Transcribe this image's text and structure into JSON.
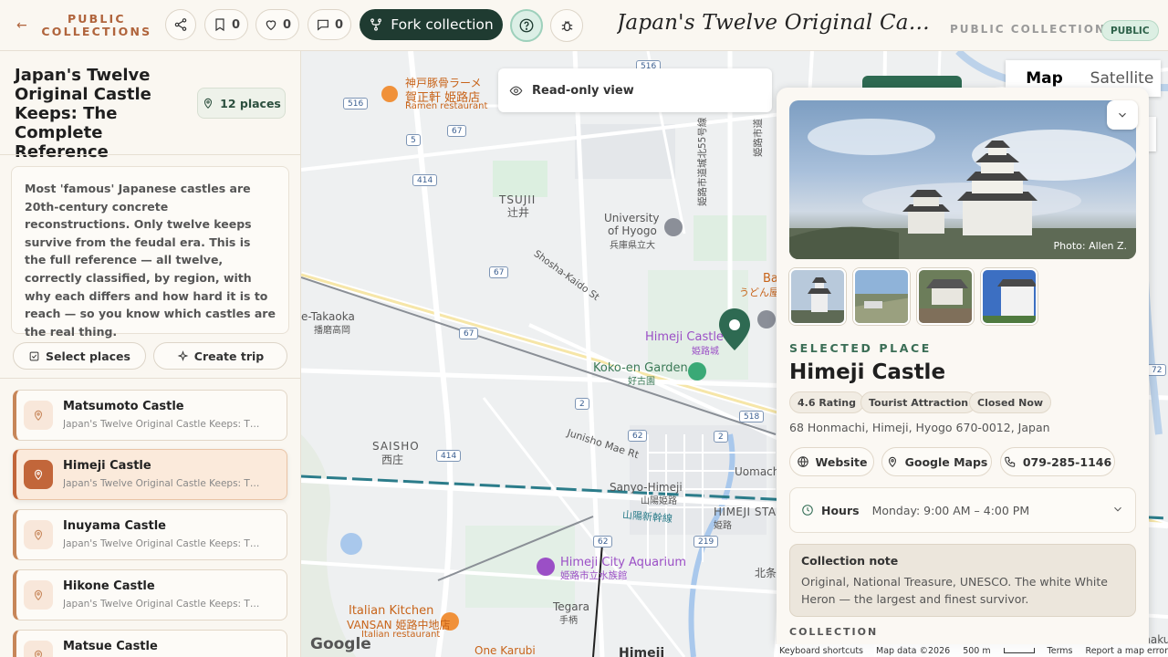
{
  "header": {
    "back_label": "PUBLIC COLLECTIONS",
    "share_icon": "share-icon",
    "bookmark_count": "0",
    "like_count": "0",
    "comment_count": "0",
    "fork_label": "Fork collection",
    "title": "Japan's Twelve Original Castle Ke...",
    "subtitle": "PUBLIC COLLECTION",
    "badge": "PUBLIC"
  },
  "sidebar": {
    "title": "Japan's Twelve Original Castle Keeps: The Complete Reference",
    "places_chip": "12 places",
    "description": "Most 'famous' Japanese castles are 20th-century concrete reconstructions. Only twelve keeps survive from the feudal era. This is the full reference — all twelve, correctly classified, by region, with why each differs and how hard it is to reach — so you know which castles are the real thing.",
    "select_label": "Select places",
    "trip_label": "Create trip",
    "places": [
      {
        "name": "Matsumoto Castle",
        "sub": "Japan's Twelve Original Castle Keeps: The Complete Reference"
      },
      {
        "name": "Himeji Castle",
        "sub": "Japan's Twelve Original Castle Keeps: The Complete Reference"
      },
      {
        "name": "Inuyama Castle",
        "sub": "Japan's Twelve Original Castle Keeps: The Complete Reference"
      },
      {
        "name": "Hikone Castle",
        "sub": "Japan's Twelve Original Castle Keeps: The Complete Reference"
      },
      {
        "name": "Matsue Castle",
        "sub": ""
      }
    ]
  },
  "map": {
    "readonly_label": "Read-only view",
    "map_label": "Map",
    "satellite_label": "Satellite",
    "labels": {
      "ramen_1": "神戸豚骨ラーメ",
      "ramen_2": "賀正軒 姫路店",
      "ramen_3": "Ramen restaurant",
      "tsujii_en": "TSUJII",
      "tsujii_jp": "辻井",
      "univ_1": "University",
      "univ_2": "of Hyogo",
      "univ_3": "兵庫県立大",
      "shosha": "Shosha-Kaido St",
      "takaoka_en": "e-Takaoka",
      "takaoka_jp": "播磨高岡",
      "himeji_castle": "Himeji Castle",
      "himeji_castle_jp": "姫路城",
      "kokoen": "Koko-en Garden",
      "kokoen_jp": "好古園",
      "saisho_en": "SAISHO",
      "saisho_jp": "西庄",
      "junisho": "Junisho Mae Rt",
      "uomachi": "Uomachi",
      "sanyo": "Sanyo-Himeji",
      "sanyo_jp": "山陽姫路",
      "himeji_sta": "HIMEJI STA",
      "himeji_sta_jp": "姫路",
      "shinkansen": "山陽新幹線",
      "aquarium": "Himeji City Aquarium",
      "aquarium_jp": "姫路市立水族館",
      "tegara": "Tegara",
      "tegara_jp": "手柄",
      "italian_1": "Italian Kitchen",
      "italian_2": "VANSAN 姫路中地店",
      "italian_3": "Italian restaurant",
      "one_karubi": "One Karubi",
      "himeji_city": "Himeji",
      "ba": "Ba",
      "udon": "うどん屋",
      "road_vertical": "姫路市道城北55号線",
      "road_vertical2": "姫路市道",
      "kita": "北条",
      "gochaku": "Gochaku"
    },
    "shields": [
      "516",
      "516",
      "5",
      "67",
      "414",
      "67",
      "67",
      "2",
      "62",
      "2",
      "518",
      "414",
      "62",
      "219",
      "72"
    ],
    "google": "Google",
    "attribution": [
      "Keyboard shortcuts",
      "Map data ©2026",
      "500 m",
      "Terms",
      "Report a map error"
    ]
  },
  "place": {
    "photo_credit": "Photo: Allen Z.",
    "eyebrow": "SELECTED PLACE",
    "name": "Himeji Castle",
    "tags": [
      "4.6 Rating",
      "Tourist Attraction",
      "Closed Now"
    ],
    "address": "68 Honmachi, Himeji, Hyogo 670-0012, Japan",
    "website_label": "Website",
    "maps_label": "Google Maps",
    "phone": "079-285-1146",
    "hours_label": "Hours",
    "hours_value": "Monday: 9:00 AM – 4:00 PM",
    "note_title": "Collection note",
    "note_body": "Original, National Treasure, UNESCO. The white White Heron — the largest and finest survivor.",
    "collection_header": "COLLECTION"
  },
  "colors": {
    "accent_green": "#1f3b31",
    "accent_rust": "#c2663a",
    "map_pin": "#2e6a52"
  }
}
